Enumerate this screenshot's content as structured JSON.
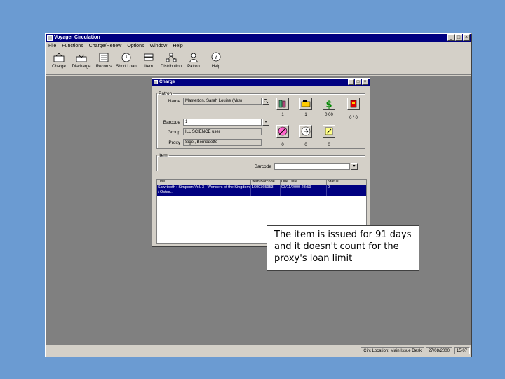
{
  "app": {
    "title": "Voyager Circulation",
    "window_buttons": [
      "_",
      "□",
      "×"
    ]
  },
  "menu": [
    "File",
    "Functions",
    "Charge/Renew",
    "Options",
    "Window",
    "Help"
  ],
  "toolbar": [
    {
      "label": "Charge",
      "icon": "charge-icon"
    },
    {
      "label": "Discharge",
      "icon": "discharge-icon"
    },
    {
      "label": "Records",
      "icon": "records-icon"
    },
    {
      "label": "Short Loan",
      "icon": "short-loan-icon"
    },
    {
      "label": "Item",
      "icon": "item-icon"
    },
    {
      "label": "Distribution",
      "icon": "distribution-icon"
    },
    {
      "label": "Patron",
      "icon": "patron-icon"
    },
    {
      "label": "Help",
      "icon": "help-icon"
    }
  ],
  "charge_window": {
    "title": "Charge",
    "patron_legend": "Patron",
    "fields": {
      "name_label": "Name",
      "name_value": "Masterton, Sarah Louise (Mrs)",
      "barcode_label": "Barcode",
      "barcode_value": "1",
      "group_label": "Group",
      "group_value": "ILL SCIENCE user",
      "proxy_label": "Proxy",
      "proxy_value": "Sigel, Bernadette"
    },
    "counts_top": [
      "1",
      "1",
      "0.00",
      "0 / 0"
    ],
    "counts_bottom": [
      "0",
      "0",
      "0"
    ],
    "item_legend": "Item",
    "item_barcode_label": "Barcode",
    "grid": {
      "headers": [
        "Title",
        "Item Barcode",
        "Due Date",
        "Status"
      ],
      "rows": [
        {
          "title": "Saw-tooth : Simpson Vol. 3 : Wonders of the Kingdom / Osteo...",
          "barcode": "1600365953",
          "due": "03/11/2000 23:59",
          "status": "0"
        }
      ]
    }
  },
  "status_bar": [
    "Circ Location: Main Issue Desk",
    "27/08/2000",
    "15:07"
  ],
  "callout": "The item is issued for 91 days and it doesn't count for the proxy's loan limit",
  "colors": {
    "desktop": "#6b9bd2",
    "titlebar": "#000080",
    "chrome": "#d4d0c8",
    "workspace": "#808080",
    "selected_row": "#000080"
  }
}
